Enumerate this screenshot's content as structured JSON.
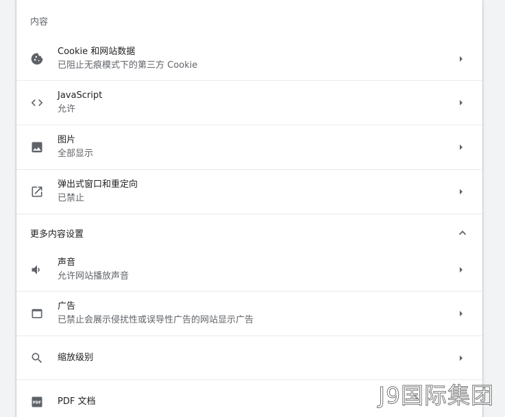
{
  "content_section": {
    "header": "内容",
    "items": [
      {
        "title": "Cookie 和网站数据",
        "subtitle": "已阻止无痕模式下的第三方 Cookie",
        "icon": "cookie-icon"
      },
      {
        "title": "JavaScript",
        "subtitle": "允许",
        "icon": "code-icon"
      },
      {
        "title": "图片",
        "subtitle": "全部显示",
        "icon": "image-icon"
      },
      {
        "title": "弹出式窗口和重定向",
        "subtitle": "已禁止",
        "icon": "open-in-new-icon"
      }
    ]
  },
  "more_section": {
    "header": "更多内容设置",
    "items": [
      {
        "title": "声音",
        "subtitle": "允许网站播放声音",
        "icon": "volume-icon"
      },
      {
        "title": "广告",
        "subtitle": "已禁止会展示侵扰性或误导性广告的网站显示广告",
        "icon": "ads-icon"
      },
      {
        "title": "缩放级别",
        "icon": "search-icon"
      },
      {
        "title": "PDF 文档",
        "icon": "pdf-icon"
      }
    ]
  },
  "watermark": "J9国际集团",
  "colors": {
    "icon": "#5f6368",
    "text_primary": "#202124",
    "text_secondary": "#5f6368",
    "divider": "#e8eaed"
  }
}
